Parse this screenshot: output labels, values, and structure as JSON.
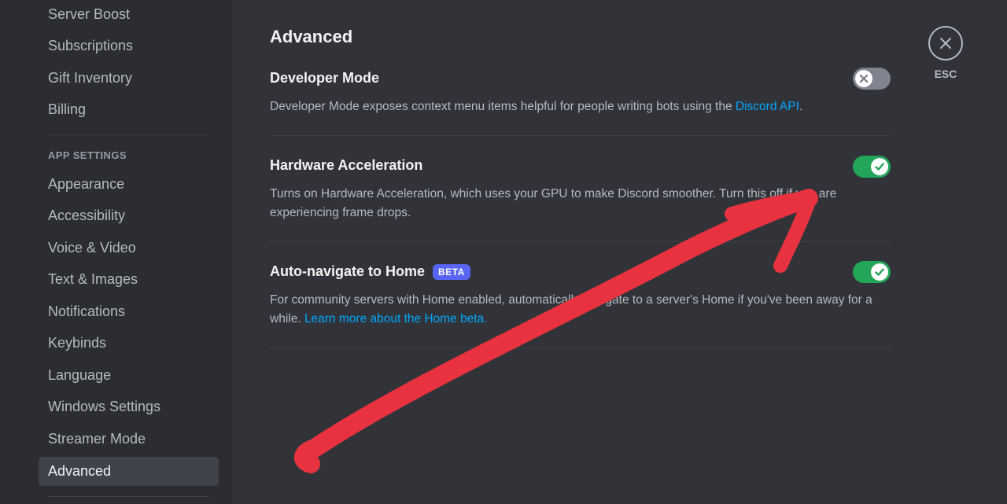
{
  "sidebar": {
    "items_top": [
      {
        "label": "Server Boost"
      },
      {
        "label": "Subscriptions"
      },
      {
        "label": "Gift Inventory"
      },
      {
        "label": "Billing"
      }
    ],
    "section_header": "APP SETTINGS",
    "items_app": [
      {
        "label": "Appearance"
      },
      {
        "label": "Accessibility"
      },
      {
        "label": "Voice & Video"
      },
      {
        "label": "Text & Images"
      },
      {
        "label": "Notifications"
      },
      {
        "label": "Keybinds"
      },
      {
        "label": "Language"
      },
      {
        "label": "Windows Settings"
      },
      {
        "label": "Streamer Mode"
      },
      {
        "label": "Advanced",
        "active": true
      }
    ]
  },
  "main": {
    "title": "Advanced",
    "settings": [
      {
        "title": "Developer Mode",
        "description": "Developer Mode exposes context menu items helpful for people writing bots using the ",
        "link": "Discord API",
        "description_suffix": ".",
        "enabled": false
      },
      {
        "title": "Hardware Acceleration",
        "description": "Turns on Hardware Acceleration, which uses your GPU to make Discord smoother. Turn this off if you are experiencing frame drops.",
        "enabled": true
      },
      {
        "title": "Auto-navigate to Home",
        "badge": "BETA",
        "description": "For community servers with Home enabled, automatically navigate to a server's Home if you've been away for a while. ",
        "link": "Learn more about the Home beta.",
        "enabled": true
      }
    ]
  },
  "close": {
    "label": "ESC",
    "icon": "close-icon"
  },
  "annotation": {
    "color": "#e8323f",
    "icon": "red-arrow-annotation"
  },
  "colors": {
    "sidebar_bg": "#2b2d31",
    "main_bg": "#313338",
    "toggle_on": "#23a55a",
    "toggle_off": "#80848e",
    "link": "#00a8fc",
    "beta_badge": "#5865f2"
  }
}
